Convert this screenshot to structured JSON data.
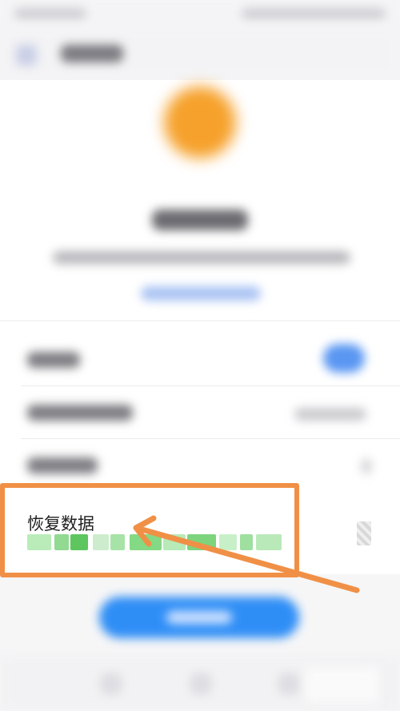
{
  "restore": {
    "title": "恢复数据"
  },
  "colors": {
    "accent_blue": "#2f8ef6",
    "sun_orange": "#f6a12b",
    "highlight_orange": "#f09046",
    "subtitle_green": "#84d984"
  },
  "icons": {
    "back": "back-arrow-icon",
    "hero": "cloud-sun-icon",
    "row_side": "qr-code-icon"
  }
}
